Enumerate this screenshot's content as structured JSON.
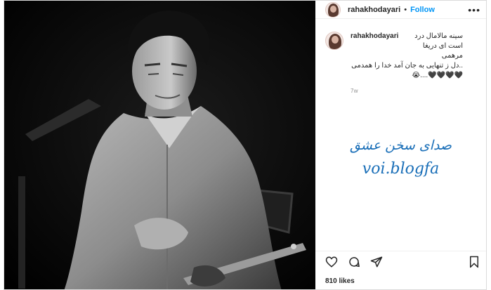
{
  "post": {
    "username": "rahakhodayari",
    "separator": "•",
    "follow_label": "Follow",
    "more_label": "•••",
    "caption_line1": "سینه مالامال درد است ای دریغا",
    "caption_line2": "مرهمی",
    "caption_line3": "..دل ز تنهایی به جان آمد خدا را همدمی",
    "caption_line4": "🖤🖤🖤🖤....😭",
    "time_ago": "7w",
    "likes": "810 likes"
  },
  "watermark": {
    "line1": "صدای سخن عشق",
    "line2": "voi.blogfa"
  },
  "icons": {
    "like": "heart-icon",
    "comment": "comment-icon",
    "share": "share-icon",
    "save": "bookmark-icon"
  },
  "colors": {
    "follow": "#0095f6",
    "watermark": "#1a6fb8",
    "muted": "#8e8e8e"
  }
}
